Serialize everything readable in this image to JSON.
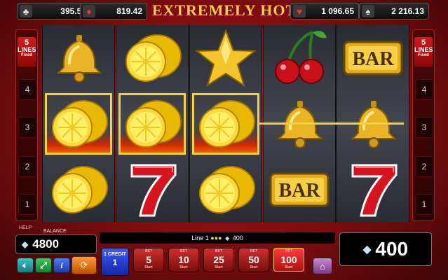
{
  "title": "EXTREMELY HOT",
  "jackpots": [
    {
      "suit": "club",
      "glyph": "♣",
      "color": "#e0e0e0",
      "value": "395.53"
    },
    {
      "suit": "diamond",
      "glyph": "♦",
      "color": "#ff3030",
      "value": "819.42"
    },
    {
      "suit": "heart",
      "glyph": "♥",
      "color": "#ff3030",
      "value": "1 096.65"
    },
    {
      "suit": "spade",
      "glyph": "♠",
      "color": "#e0e0e0",
      "value": "2 216.13"
    }
  ],
  "lines_panel": {
    "count": "5",
    "label": "LINES",
    "mode": "Fixed",
    "numbers": [
      "4",
      "3",
      "2",
      "1"
    ]
  },
  "reels": [
    [
      "bell",
      "lemon",
      "lemon"
    ],
    [
      "lemon",
      "lemon",
      "seven"
    ],
    [
      "star",
      "lemon",
      "lemon"
    ],
    [
      "cherries",
      "bell",
      "bar"
    ],
    [
      "bar",
      "bell",
      "seven"
    ]
  ],
  "winning_cells": [
    [
      0,
      1
    ],
    [
      1,
      1
    ],
    [
      2,
      1
    ]
  ],
  "help_label": "HELP",
  "balance": {
    "label": "BALANCE",
    "value": "4800"
  },
  "win_line_text": {
    "prefix": "Line 1",
    "amount": "400"
  },
  "win": "400",
  "credit": {
    "label": "1 CREDIT",
    "value": "1"
  },
  "bets": [
    {
      "label": "BET",
      "value": "5",
      "sub": "Start",
      "active": false
    },
    {
      "label": "BET",
      "value": "10",
      "sub": "Start",
      "active": false
    },
    {
      "label": "BET",
      "value": "25",
      "sub": "Start",
      "active": false
    },
    {
      "label": "BET",
      "value": "50",
      "sub": "Start",
      "active": false
    },
    {
      "label": "BET",
      "value": "100",
      "sub": "Start",
      "active": true
    }
  ],
  "icons": {
    "sound": "speaker-icon",
    "fullscreen": "fullscreen-icon",
    "info": "info-icon",
    "autoplay": "autoplay-icon",
    "home": "home-icon",
    "currency": "diamond-gem-icon"
  },
  "colors": {
    "accent": "#f2d23a",
    "background": "#b8161a"
  }
}
